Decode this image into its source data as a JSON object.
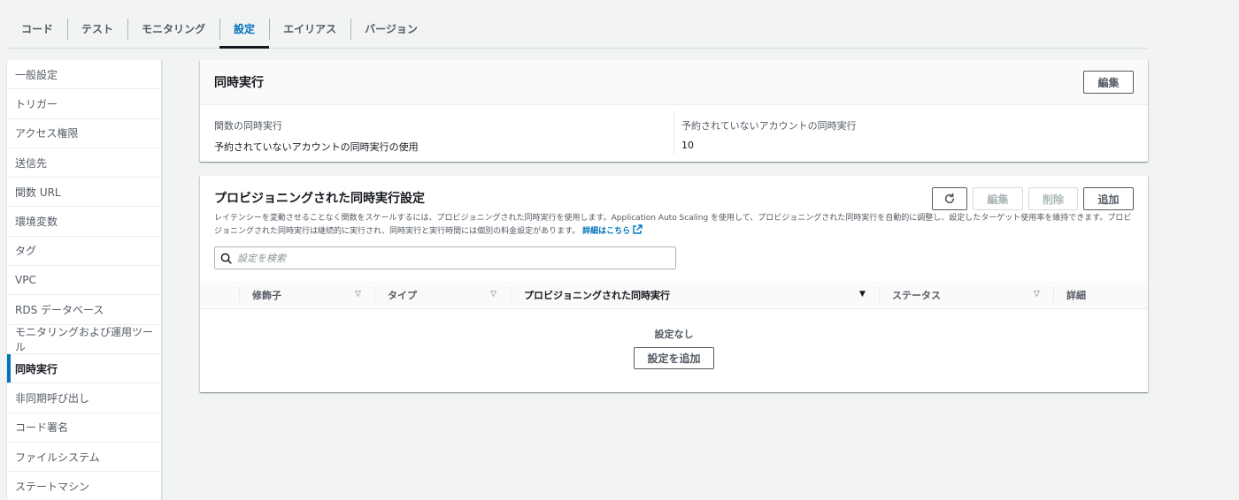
{
  "tabs": [
    {
      "label": "コード",
      "active": false
    },
    {
      "label": "テスト",
      "active": false
    },
    {
      "label": "モニタリング",
      "active": false
    },
    {
      "label": "設定",
      "active": true
    },
    {
      "label": "エイリアス",
      "active": false
    },
    {
      "label": "バージョン",
      "active": false
    }
  ],
  "sidebar": {
    "items": [
      {
        "label": "一般設定"
      },
      {
        "label": "トリガー"
      },
      {
        "label": "アクセス権限"
      },
      {
        "label": "送信先"
      },
      {
        "label": "関数 URL"
      },
      {
        "label": "環境変数"
      },
      {
        "label": "タグ"
      },
      {
        "label": "VPC"
      },
      {
        "label": "RDS データベース"
      },
      {
        "label": "モニタリングおよび運用ツール"
      },
      {
        "label": "同時実行",
        "active": true
      },
      {
        "label": "非同期呼び出し"
      },
      {
        "label": "コード署名"
      },
      {
        "label": "ファイルシステム"
      },
      {
        "label": "ステートマシン"
      }
    ]
  },
  "concurrency": {
    "title": "同時実行",
    "edit_label": "編集",
    "function_label": "関数の同時実行",
    "function_value": "予約されていないアカウントの同時実行の使用",
    "unreserved_label": "予約されていないアカウントの同時実行",
    "unreserved_value": "10"
  },
  "provisioned": {
    "title": "プロビジョニングされた同時実行設定",
    "refresh_icon": "refresh-icon",
    "edit_label": "編集",
    "delete_label": "削除",
    "add_label": "追加",
    "description": "レイテンシーを変動させることなく関数をスケールするには、プロビジョニングされた同時実行を使用します。Application Auto Scaling を使用して、プロビジョニングされた同時実行を自動的に調整し、設定したターゲット使用率を維持できます。プロビジョニングされた同時実行は継続的に実行され、同時実行と実行時間には個別の料金設定があります。",
    "learn_more": "詳細はこちら",
    "search_placeholder": "設定を検索",
    "columns": [
      {
        "label": "修飾子"
      },
      {
        "label": "タイプ"
      },
      {
        "label": "プロビジョニングされた同時実行",
        "sorted": true
      },
      {
        "label": "ステータス"
      },
      {
        "label": "詳細"
      }
    ],
    "empty_text": "設定なし",
    "add_config_label": "設定を追加"
  },
  "colors": {
    "accent": "#0073bb",
    "text": "#16191f",
    "muted": "#545b64",
    "background": "#f2f3f3"
  }
}
